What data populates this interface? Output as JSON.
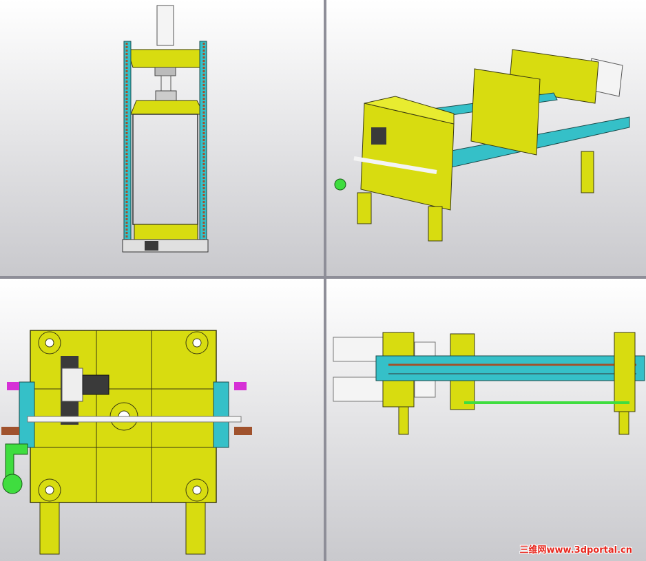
{
  "colors": {
    "frame": "#d8dc10",
    "frame_stroke": "#3a3a10",
    "rail": "#35c0c8",
    "chain": "#a0522d",
    "cylinder": "#f4f4f4",
    "motor": "#3a3a3a",
    "accent_green": "#3fdd3f",
    "accent_magenta": "#d630d6",
    "viewport_bg_top": "#ffffff",
    "viewport_bg_bottom": "#c9c9cd",
    "watermark": "#e8271e"
  },
  "viewports": [
    {
      "id": "top-view",
      "icon": "top-view-model"
    },
    {
      "id": "isometric-view",
      "icon": "isometric-view-model"
    },
    {
      "id": "front-view",
      "icon": "front-view-model"
    },
    {
      "id": "side-view",
      "icon": "side-view-model"
    }
  ],
  "watermark": {
    "text": "三维网www.3dportal.cn"
  }
}
